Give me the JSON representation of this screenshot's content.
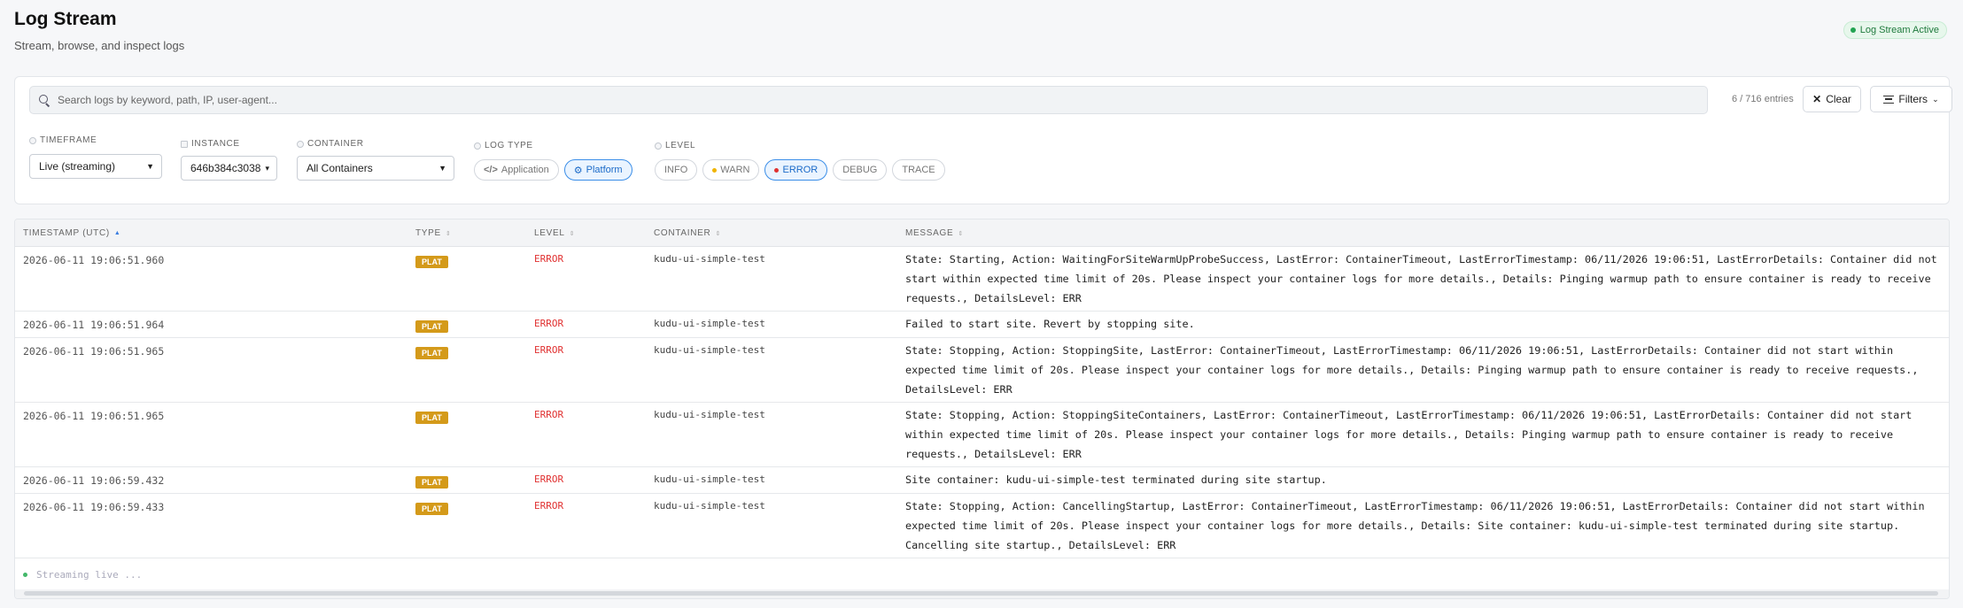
{
  "header": {
    "title": "Log Stream",
    "subtitle": "Stream, browse, and inspect logs",
    "status": "Log Stream Active"
  },
  "search": {
    "placeholder": "Search logs by keyword, path, IP, user-agent...",
    "value": "",
    "entries": "6 / 716 entries",
    "clear_label": "Clear",
    "filters_label": "Filters"
  },
  "filters": {
    "timeframe": {
      "label": "TIMEFRAME",
      "value": "Live (streaming)"
    },
    "instance": {
      "label": "INSTANCE",
      "value": "646b384c3038"
    },
    "container": {
      "label": "CONTAINER",
      "value": "All Containers"
    },
    "log_type": {
      "label": "LOG TYPE",
      "options": [
        "Application",
        "Platform"
      ],
      "active": "Platform"
    },
    "level": {
      "label": "LEVEL",
      "options": [
        "INFO",
        "WARN",
        "ERROR",
        "DEBUG",
        "TRACE"
      ],
      "active": "ERROR"
    }
  },
  "table": {
    "columns": [
      "TIMESTAMP (UTC)",
      "TYPE",
      "LEVEL",
      "CONTAINER",
      "MESSAGE"
    ],
    "rows": [
      {
        "timestamp": "2026-06-11 19:06:51.960",
        "type": "PLAT",
        "level": "ERROR",
        "container": "kudu-ui-simple-test",
        "message": "State: Starting, Action: WaitingForSiteWarmUpProbeSuccess, LastError: ContainerTimeout, LastErrorTimestamp: 06/11/2026 19:06:51, LastErrorDetails: Container did not start within expected time limit of 20s. Please inspect your container logs for more details., Details: Pinging warmup path to ensure container is ready to receive requests., DetailsLevel: ERR"
      },
      {
        "timestamp": "2026-06-11 19:06:51.964",
        "type": "PLAT",
        "level": "ERROR",
        "container": "kudu-ui-simple-test",
        "message": "Failed to start site. Revert by stopping site."
      },
      {
        "timestamp": "2026-06-11 19:06:51.965",
        "type": "PLAT",
        "level": "ERROR",
        "container": "kudu-ui-simple-test",
        "message": "State: Stopping, Action: StoppingSite, LastError: ContainerTimeout, LastErrorTimestamp: 06/11/2026 19:06:51, LastErrorDetails: Container did not start within expected time limit of 20s. Please inspect your container logs for more details., Details: Pinging warmup path to ensure container is ready to receive requests., DetailsLevel: ERR"
      },
      {
        "timestamp": "2026-06-11 19:06:51.965",
        "type": "PLAT",
        "level": "ERROR",
        "container": "kudu-ui-simple-test",
        "message": "State: Stopping, Action: StoppingSiteContainers, LastError: ContainerTimeout, LastErrorTimestamp: 06/11/2026 19:06:51, LastErrorDetails: Container did not start within expected time limit of 20s. Please inspect your container logs for more details., Details: Pinging warmup path to ensure container is ready to receive requests., DetailsLevel: ERR"
      },
      {
        "timestamp": "2026-06-11 19:06:59.432",
        "type": "PLAT",
        "level": "ERROR",
        "container": "kudu-ui-simple-test",
        "message": "Site container: kudu-ui-simple-test terminated during site startup."
      },
      {
        "timestamp": "2026-06-11 19:06:59.433",
        "type": "PLAT",
        "level": "ERROR",
        "container": "kudu-ui-simple-test",
        "message": "State: Stopping, Action: CancellingStartup, LastError: ContainerTimeout, LastErrorTimestamp: 06/11/2026 19:06:51, LastErrorDetails: Container did not start within expected time limit of 20s. Please inspect your container logs for more details., Details: Site container: kudu-ui-simple-test terminated during site startup. Cancelling site startup., DetailsLevel: ERR"
      }
    ],
    "streaming_text": "Streaming live ..."
  },
  "colors": {
    "accent": "#3b8ee8",
    "error": "#e03131",
    "warn": "#f0b400",
    "plat_badge": "#d49a1a",
    "live": "#22a352"
  }
}
